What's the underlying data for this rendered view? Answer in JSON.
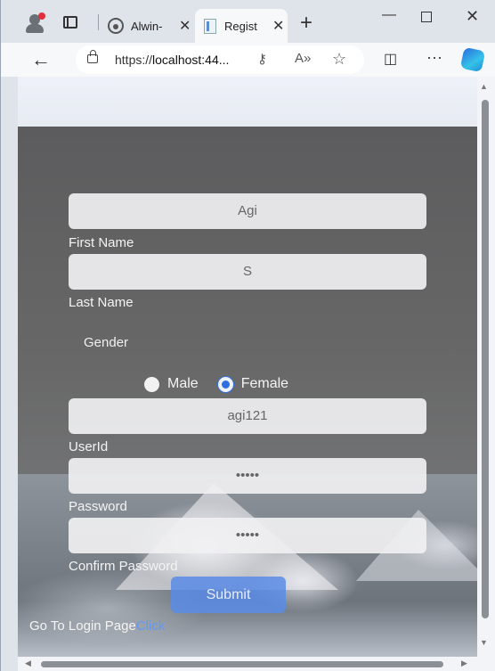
{
  "browser": {
    "tabs": [
      {
        "label": "Alwin-",
        "icon": "github-icon"
      },
      {
        "label": "Regist",
        "icon": "page-icon"
      }
    ],
    "address": {
      "prefix": "https://",
      "host": "localhost:44..."
    }
  },
  "form": {
    "first_name_value": "Agi",
    "first_name_label": "First Name",
    "last_name_value": "S",
    "last_name_label": "Last Name",
    "gender_label": "Gender",
    "gender_options": [
      "Male",
      "Female"
    ],
    "gender_selected": "Female",
    "userid_value": "agi121",
    "userid_label": "UserId",
    "password_value": "•••••",
    "password_label": "Password",
    "confirm_value": "•••••",
    "confirm_label": "Confirm Password",
    "submit_label": "Submit",
    "goto_text": "Go To Login Page",
    "goto_link": "Click"
  },
  "colors": {
    "accent": "#2f6fe0",
    "link": "#5e9af5",
    "submit": "#5a8ce6"
  }
}
